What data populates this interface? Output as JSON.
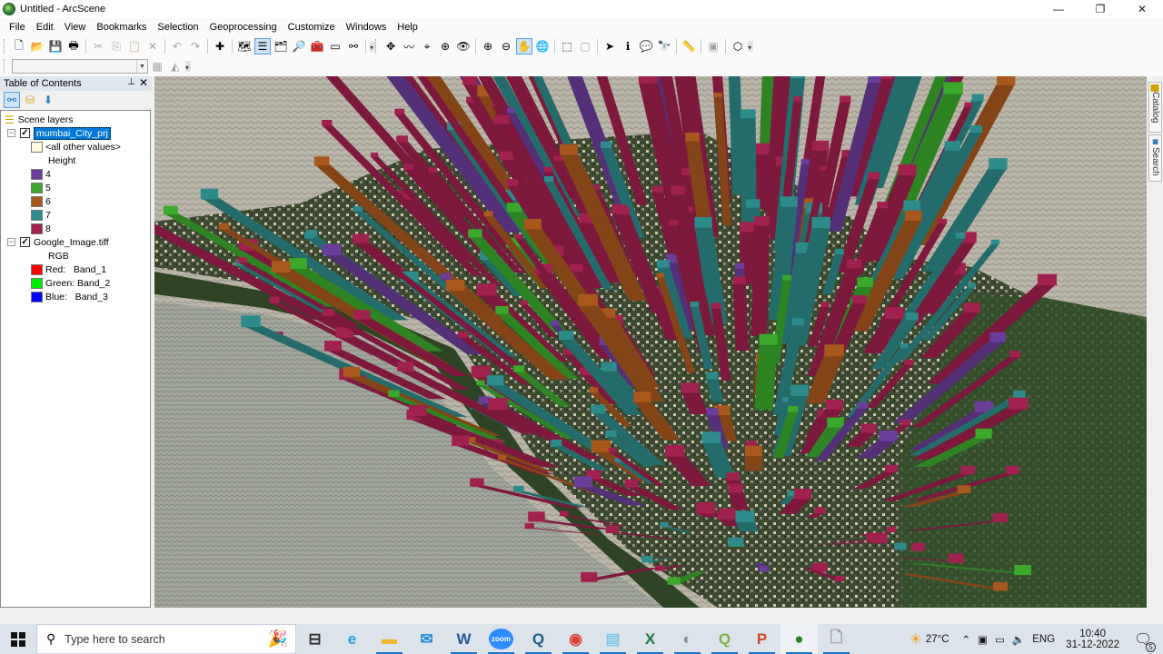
{
  "window": {
    "title": "Untitled - ArcScene",
    "controls": {
      "minimize": "—",
      "maximize": "❐",
      "close": "✕"
    }
  },
  "menubar": [
    "File",
    "Edit",
    "View",
    "Bookmarks",
    "Selection",
    "Geoprocessing",
    "Customize",
    "Windows",
    "Help"
  ],
  "toolbar": {
    "standard": [
      {
        "name": "new-document",
        "glyph": "🗋"
      },
      {
        "name": "open",
        "glyph": "📂"
      },
      {
        "name": "save",
        "glyph": "💾"
      },
      {
        "name": "print",
        "glyph": "🖶"
      },
      {
        "name": "cut",
        "glyph": "✂",
        "disabled": true
      },
      {
        "name": "copy",
        "glyph": "⎘",
        "disabled": true
      },
      {
        "name": "paste",
        "glyph": "📋",
        "disabled": true
      },
      {
        "name": "delete",
        "glyph": "✕",
        "disabled": true
      },
      {
        "name": "undo",
        "glyph": "↶",
        "disabled": true
      },
      {
        "name": "redo",
        "glyph": "↷",
        "disabled": true
      },
      {
        "name": "add-data",
        "glyph": "✚"
      },
      {
        "name": "arctoolbox",
        "glyph": "🗺"
      },
      {
        "name": "table-of-contents",
        "glyph": "☰",
        "active": true
      },
      {
        "name": "catalog-window",
        "glyph": "🗂"
      },
      {
        "name": "search-window",
        "glyph": "🔎"
      },
      {
        "name": "toolbox",
        "glyph": "🧰"
      },
      {
        "name": "python-window",
        "glyph": "▭"
      },
      {
        "name": "model-builder",
        "glyph": "⚯"
      }
    ],
    "tools": [
      {
        "name": "navigate",
        "glyph": "✥"
      },
      {
        "name": "fly",
        "glyph": "〰"
      },
      {
        "name": "center-on-target",
        "glyph": "⌖"
      },
      {
        "name": "zoom-to-target",
        "glyph": "⊕"
      },
      {
        "name": "set-observer",
        "glyph": "👁"
      },
      {
        "name": "zoom-in",
        "glyph": "⊕"
      },
      {
        "name": "zoom-out",
        "glyph": "⊖"
      },
      {
        "name": "pan",
        "glyph": "✋",
        "active": true
      },
      {
        "name": "full-extent",
        "glyph": "🌐"
      },
      {
        "name": "select-features",
        "glyph": "⬚"
      },
      {
        "name": "clear-selection",
        "glyph": "▢",
        "disabled": true
      },
      {
        "name": "select-elements",
        "glyph": "➤"
      },
      {
        "name": "identify",
        "glyph": "ℹ"
      },
      {
        "name": "html-popup",
        "glyph": "💬"
      },
      {
        "name": "find",
        "glyph": "🔭"
      },
      {
        "name": "measure",
        "glyph": "📏"
      },
      {
        "name": "animation",
        "glyph": "▣",
        "disabled": true
      },
      {
        "name": "3d-effects",
        "glyph": "⬡"
      }
    ],
    "layer_combo_value": ""
  },
  "toc": {
    "title": "Table of Contents",
    "pin": "⊥",
    "close": "✕",
    "root": "Scene layers",
    "layers": [
      {
        "name": "mumbai_City_prj",
        "checked": true,
        "selected": true,
        "default_label": "<all other values>",
        "default_color": "#fffde0",
        "field": "Height",
        "classes": [
          {
            "label": "4",
            "color": "#6a3d9a"
          },
          {
            "label": "5",
            "color": "#3ba82b"
          },
          {
            "label": "6",
            "color": "#a8581d"
          },
          {
            "label": "7",
            "color": "#2e8b8b"
          },
          {
            "label": "8",
            "color": "#a0204e"
          }
        ]
      },
      {
        "name": "Google_Image.tiff",
        "checked": true,
        "selected": false,
        "field": "RGB",
        "classes": [
          {
            "label": "Red:   Band_1",
            "color": "#ff0000"
          },
          {
            "label": "Green: Band_2",
            "color": "#00ee00"
          },
          {
            "label": "Blue:   Band_3",
            "color": "#0000ff"
          }
        ]
      }
    ]
  },
  "dock_tabs": [
    "Catalog",
    "Search"
  ],
  "taskbar": {
    "search_placeholder": "Type here to search",
    "apps": [
      {
        "name": "task-view",
        "glyph": "⊟",
        "running": false
      },
      {
        "name": "edge",
        "glyph": "e",
        "color": "#1ea0d8",
        "running": false
      },
      {
        "name": "file-explorer",
        "glyph": "▬",
        "color": "#f2b632",
        "running": true
      },
      {
        "name": "mail",
        "glyph": "✉",
        "color": "#1f8ad6",
        "running": false
      },
      {
        "name": "word",
        "glyph": "W",
        "color": "#2b579a",
        "running": true
      },
      {
        "name": "zoom",
        "glyph": "zoom",
        "color": "#2d8cff",
        "running": true
      },
      {
        "name": "arcgis-search",
        "glyph": "Q",
        "color": "#1b5e8c",
        "running": true
      },
      {
        "name": "chrome",
        "glyph": "◉",
        "color": "#db4437",
        "running": true
      },
      {
        "name": "notepad",
        "glyph": "▤",
        "color": "#7fc8e8",
        "running": true
      },
      {
        "name": "excel",
        "glyph": "X",
        "color": "#217346",
        "running": true
      },
      {
        "name": "google-earth-pro",
        "glyph": "◐",
        "color": "#888",
        "running": true
      },
      {
        "name": "qgis",
        "glyph": "Q",
        "color": "#7cb342",
        "running": true
      },
      {
        "name": "powerpoint",
        "glyph": "P",
        "color": "#d24726",
        "running": true
      },
      {
        "name": "arcscene",
        "glyph": "●",
        "color": "#2f7d2a",
        "running": true,
        "active": true
      },
      {
        "name": "blank-document",
        "glyph": "🗋",
        "color": "#fff",
        "running": true
      }
    ],
    "weather": "27°C",
    "language": "ENG",
    "time": "10:40",
    "date": "31-12-2022",
    "notifications": "5"
  },
  "scene": {
    "legend_colors": {
      "h4": "#6a3d9a",
      "h5": "#3ba82b",
      "h6": "#a8581d",
      "h7": "#2e8b8b",
      "h8": "#a0204e"
    },
    "water_color": "#b7b3a6",
    "sea_color": "#9ea299",
    "land_color": "#3f5232"
  }
}
